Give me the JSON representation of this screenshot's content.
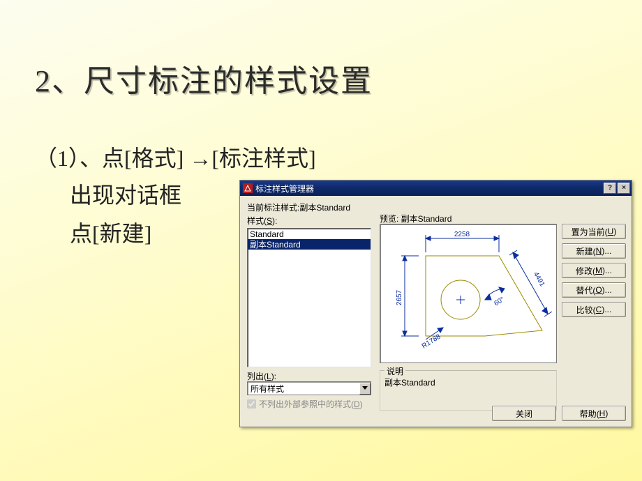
{
  "slide": {
    "heading": "2、尺寸标注的样式设置",
    "line1": "（1）、点[格式] →[标注样式]",
    "line2": "出现对话框",
    "line3": "点[新建]"
  },
  "dialog": {
    "title": "标注样式管理器",
    "current_label": "当前标注样式:副本Standard",
    "styles_label": "样式(S):",
    "list_items": [
      "Standard",
      "副本Standard"
    ],
    "selected_index": 1,
    "listout_label": "列出(L):",
    "dropdown_value": "所有样式",
    "checkbox_label": "不列出外部参照中的样式(D)",
    "preview_label": "预览: 副本Standard",
    "desc_legend": "说明",
    "desc_text": "副本Standard",
    "buttons": {
      "set_current": "置为当前(U)",
      "new": "新建(N)...",
      "modify": "修改(M)...",
      "override": "替代(O)...",
      "compare": "比较(C)...",
      "close": "关闭",
      "help": "帮助(H)"
    },
    "preview_dims": {
      "top": "2258",
      "left": "2657",
      "right": "4491",
      "angle": "60°",
      "radius": "R1788"
    }
  }
}
